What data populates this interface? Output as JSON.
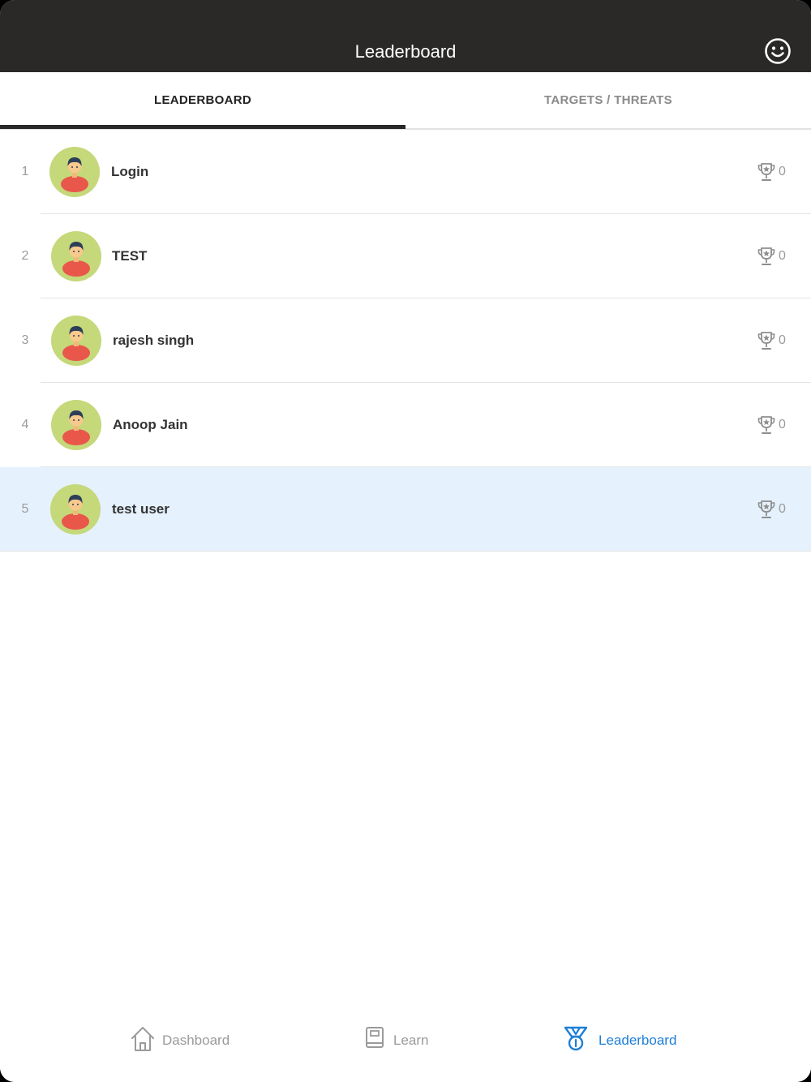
{
  "header": {
    "title": "Leaderboard",
    "profile_icon": "smiley-face-icon"
  },
  "tabs": [
    {
      "label": "LEADERBOARD",
      "active": true
    },
    {
      "label": "TARGETS / THREATS",
      "active": false
    }
  ],
  "leaderboard": [
    {
      "rank": "1",
      "name": "Login",
      "score": "0"
    },
    {
      "rank": "2",
      "name": "TEST",
      "score": "0"
    },
    {
      "rank": "3",
      "name": "rajesh singh",
      "score": "0"
    },
    {
      "rank": "4",
      "name": "Anoop Jain",
      "score": "0"
    },
    {
      "rank": "5",
      "name": "test user",
      "score": "0",
      "highlighted": true
    }
  ],
  "bottom_nav": [
    {
      "label": "Dashboard",
      "icon": "home-icon",
      "active": false
    },
    {
      "label": "Learn",
      "icon": "book-icon",
      "active": false
    },
    {
      "label": "Leaderboard",
      "icon": "medal-icon",
      "active": true
    }
  ],
  "colors": {
    "header_bg": "#2a2928",
    "accent": "#1f7fd6",
    "highlight_row": "#e5f1fc",
    "avatar_bg": "#c5d87a",
    "avatar_shirt": "#e8574a"
  }
}
